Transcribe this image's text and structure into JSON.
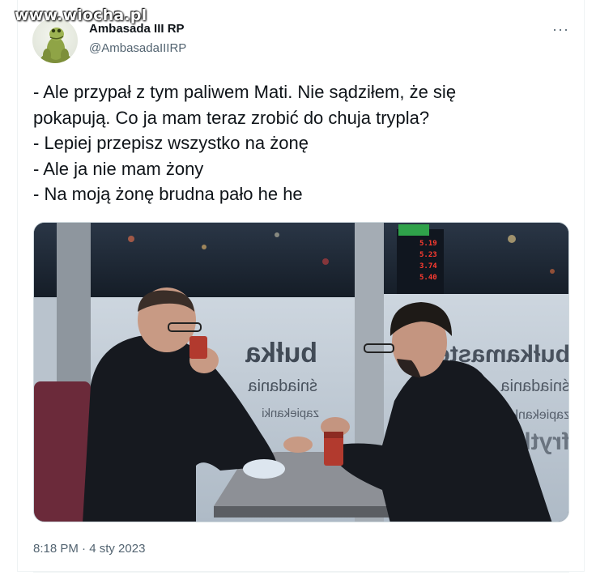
{
  "watermark": "www.wiocha.pl",
  "author": {
    "display_name": "Ambasada III RP",
    "handle": "@AmbasadaIIIRP",
    "avatar_icon": "frog-avatar-icon"
  },
  "more_icon": "more-dots-icon",
  "more_glyph": "···",
  "tweet": {
    "lines": [
      "- Ale przypał z tym paliwem Mati. Nie sądziłem, że się",
      "pokapują. Co ja mam teraz zrobić do chuja trypla?",
      "- Lepiej przepisz wszystko na żonę",
      "- Ale ja nie mam żony",
      "- Na moją żonę brudna pało he he"
    ]
  },
  "photo": {
    "window_text_mirrored": [
      "bułka",
      "śniadania",
      "zapiekanki"
    ],
    "window_text_right": [
      "bułkamaster",
      "śniadania",
      "zapiekanki",
      "frytki"
    ],
    "fuel_prices": [
      "5.19",
      "5.23",
      "3.74",
      "5.40"
    ],
    "colors": {
      "night": "#1d2a38",
      "window_frost": "#c9d3dd",
      "wall_grey": "#aeb8c2",
      "table": "#8d9096",
      "chair": "#6b2a3a",
      "coat": "#16191f",
      "cup": "#b23a2e",
      "price_digits": "#ff3b30"
    }
  },
  "timestamp": "8:18 PM · 4 sty 2023"
}
